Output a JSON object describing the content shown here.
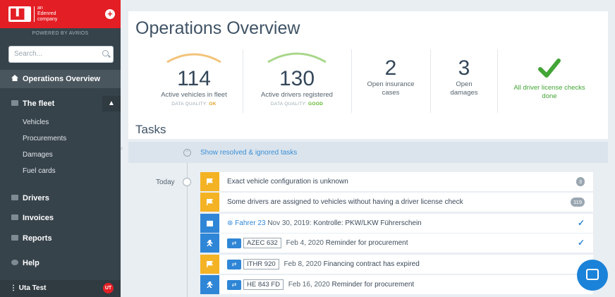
{
  "sidebar": {
    "brand_tag": [
      "an",
      "Edenred",
      "company"
    ],
    "powered_by": "POWERED BY AVRIOS",
    "search_placeholder": "Search...",
    "active_item": "Operations Overview",
    "fleet": {
      "label": "The fleet",
      "children": [
        "Vehicles",
        "Procurements",
        "Damages",
        "Fuel cards"
      ]
    },
    "items": [
      "Drivers",
      "Invoices",
      "Reports",
      "Help"
    ],
    "user_name": "Uta Test",
    "user_initials": "UT"
  },
  "header": {
    "title": "Operations Overview"
  },
  "stats": [
    {
      "value": "114",
      "label": "Active vehicles in fleet",
      "dq_label": "DATA QUALITY:",
      "dq_value": "OK",
      "dq_color": "#e2a02a",
      "gauge_color": "#f2c37a"
    },
    {
      "value": "130",
      "label": "Active drivers registered",
      "dq_label": "DATA QUALITY:",
      "dq_value": "GOOD",
      "dq_color": "#5cb52a",
      "gauge_color": "#a8d78a"
    },
    {
      "value": "2",
      "label_lines": [
        "Open insurance",
        "cases"
      ]
    },
    {
      "value": "3",
      "label_lines": [
        "Open",
        "damages"
      ]
    },
    {
      "label_lines": [
        "All driver license checks",
        "done"
      ],
      "color": "#43a536"
    }
  ],
  "tasks_title": "Tasks",
  "show_resolved": "Show resolved & ignored tasks",
  "today_label": "Today",
  "tasks": [
    {
      "text": "Exact vehicle configuration is unknown",
      "count": "3",
      "strip_color": "#f4b324"
    },
    {
      "text": "Some drivers are assigned to vehicles without having a driver license check",
      "count": "119",
      "strip_color": "#f4b324"
    },
    {
      "driver": "Fahrer 23",
      "date": "Nov 30, 2019:",
      "text": "Kontrolle: PKW/LKW Führerschein",
      "strip_color": "#2f86d6"
    },
    {
      "plate": "AZEC 632",
      "date": "Feb 4, 2020",
      "text": "Reminder for procurement",
      "strip_color": "#2f86d6"
    },
    {
      "plate": "ITHR 920",
      "date": "Feb 8, 2020",
      "text": "Financing contract has expired",
      "strip_color": "#f4b324"
    },
    {
      "plate": "HE 843 FD",
      "date": "Feb 16, 2020",
      "text": "Reminder for procurement",
      "strip_color": "#2f86d6"
    }
  ]
}
